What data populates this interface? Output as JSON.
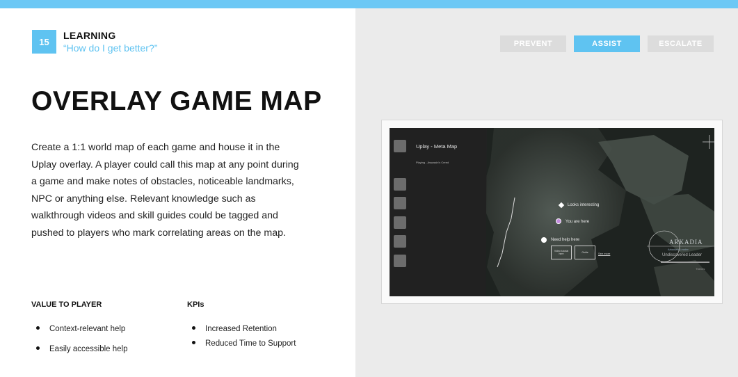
{
  "header": {
    "number": "15",
    "section": "LEARNING",
    "subtitle": "“How do I get better?”"
  },
  "headline": "OVERLAY GAME MAP",
  "description": [
    "Create a 1:1 world map of each game and house it in the",
    "Uplay overlay. A player could call this map at any point during",
    "a game and make notes of obstacles, noticeable landmarks,",
    "NPC or anything else. Relevant knowledge such as",
    "walkthrough videos and skill guides could be tagged and",
    "pushed to players who mark correlating areas on the map."
  ],
  "value_to_player": {
    "heading": "VALUE TO PLAYER",
    "items": [
      "Context-relevant help",
      "Easily accessible help"
    ]
  },
  "kpis": {
    "heading": "KPIs",
    "items": [
      "Increased Retention",
      "Reduced Time to Support"
    ]
  },
  "nav": {
    "prevent": "PREVENT",
    "assist": "ASSIST",
    "escalate": "ESCALATE",
    "active": "ASSIST",
    "active_color": "#5fc3f1",
    "inactive_color": "#dcdcdc"
  },
  "map": {
    "title": "Uplay - Meta Map",
    "playing": "Playing - Assassin's Creed",
    "pins": {
      "interesting": "Looks interesting",
      "you_are_here": "You are here",
      "need_help": "Need help here"
    },
    "buttons": {
      "video": "Video tutorial here",
      "guide": "Guide",
      "see_more": "See more"
    },
    "region": {
      "name": "ARKADIA",
      "subtitle": "Arkadia's Leader",
      "leader_status": "Undiscovered Leader",
      "owner": "Thenes"
    }
  },
  "colors": {
    "accent": "#5fc3f1",
    "top_bar": "#6cc8f5",
    "right_panel": "#ebebeb",
    "map_bg": "#1b1e1c"
  }
}
